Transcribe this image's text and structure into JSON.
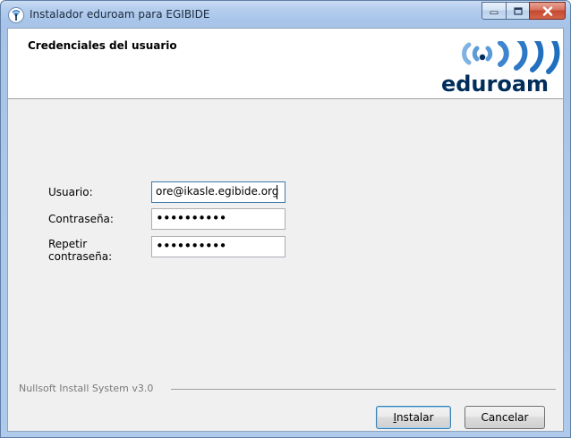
{
  "window": {
    "title": "Instalador eduroam para EGIBIDE",
    "app_icon": "eduroam-wifi-icon"
  },
  "header": {
    "title": "Credenciales del usuario",
    "logo_text": "eduroam"
  },
  "form": {
    "username_label": "Usuario:",
    "username_value": "ore@ikasle.egibide.org",
    "password_label": "Contraseña:",
    "password_value": "••••••••••",
    "repeat_label_line1": "Repetir",
    "repeat_label_line2": "contraseña:",
    "repeat_value": "••••••••••"
  },
  "footer": {
    "brand": "Nullsoft Install System v3.0",
    "install_label": "Instalar",
    "cancel_label": "Cancelar"
  },
  "colors": {
    "titlebar": "#a9c6ea",
    "close_button": "#c44a31",
    "logo_blue": "#1f6fbf",
    "logo_dark": "#002d5a"
  }
}
